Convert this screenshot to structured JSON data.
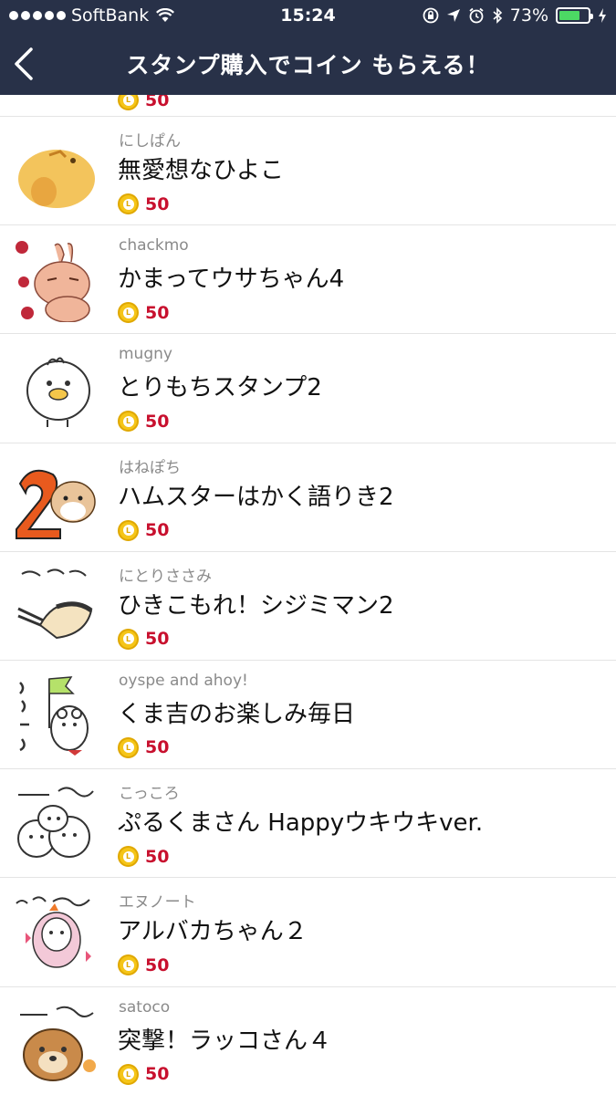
{
  "status_bar": {
    "carrier": "SoftBank",
    "time": "15:24",
    "battery": "73%",
    "battery_level": 0.73
  },
  "nav": {
    "title": "スタンプ購入でコイン もらえる！"
  },
  "colors": {
    "header_bg": "#283148",
    "price": "#c8102e",
    "coin": "#f5c518"
  },
  "peek_item": {
    "price": "50"
  },
  "items": [
    {
      "author": "にしぱん",
      "title": "無愛想なひよこ",
      "price": "50",
      "thumb_icon": "chick-sticker-icon"
    },
    {
      "author": "chackmo",
      "title": "かまってウサちゃん4",
      "price": "50",
      "thumb_icon": "rabbit-sticker-icon"
    },
    {
      "author": "mugny",
      "title": "とりもちスタンプ2",
      "price": "50",
      "thumb_icon": "bird-sticker-icon"
    },
    {
      "author": "はねぽち",
      "title": "ハムスターはかく語りき2",
      "price": "50",
      "thumb_icon": "hamster-sticker-icon"
    },
    {
      "author": "にとりささみ",
      "title": "ひきこもれ！シジミマン2",
      "price": "50",
      "thumb_icon": "clam-sticker-icon"
    },
    {
      "author": "oyspe and ahoy!",
      "title": "くま吉のお楽しみ毎日",
      "price": "50",
      "thumb_icon": "bear-flag-sticker-icon"
    },
    {
      "author": "こっころ",
      "title": "ぷるくまさん Happyウキウキver.",
      "price": "50",
      "thumb_icon": "bears-sticker-icon"
    },
    {
      "author": "エヌノート",
      "title": "アルバカちゃん２",
      "price": "50",
      "thumb_icon": "alpaca-sticker-icon"
    },
    {
      "author": "satoco",
      "title": "突撃！ラッコさん４",
      "price": "50",
      "thumb_icon": "otter-sticker-icon"
    }
  ]
}
